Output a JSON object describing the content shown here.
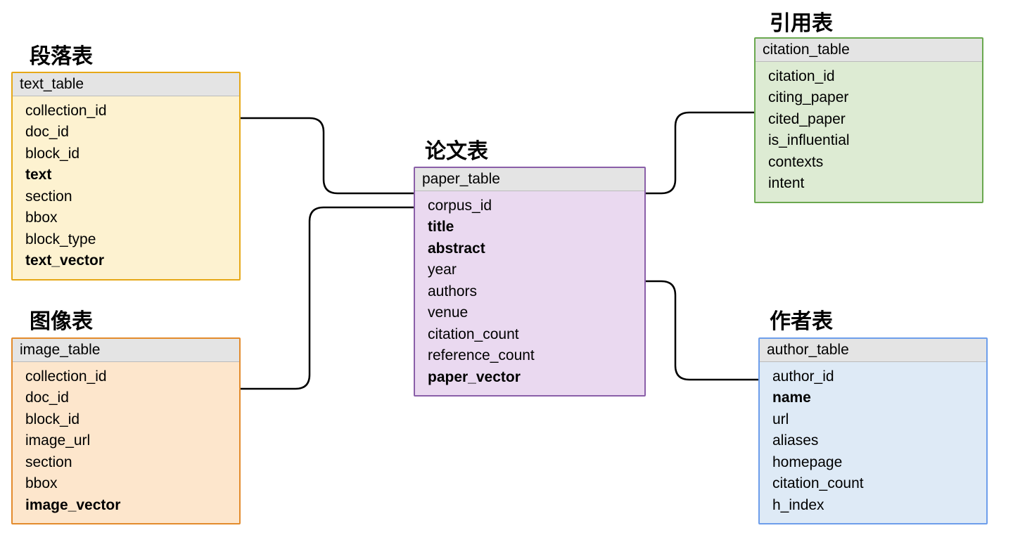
{
  "labels": {
    "text_table": "段落表",
    "image_table": "图像表",
    "paper_table": "论文表",
    "citation_table": "引用表",
    "author_table": "作者表"
  },
  "tables": {
    "text": {
      "name": "text_table",
      "fields": [
        {
          "name": "collection_id",
          "bold": false
        },
        {
          "name": "doc_id",
          "bold": false
        },
        {
          "name": "block_id",
          "bold": false
        },
        {
          "name": "text",
          "bold": true
        },
        {
          "name": "section",
          "bold": false
        },
        {
          "name": "bbox",
          "bold": false
        },
        {
          "name": "block_type",
          "bold": false
        },
        {
          "name": "text_vector",
          "bold": true
        }
      ]
    },
    "image": {
      "name": "image_table",
      "fields": [
        {
          "name": "collection_id",
          "bold": false
        },
        {
          "name": "doc_id",
          "bold": false
        },
        {
          "name": "block_id",
          "bold": false
        },
        {
          "name": "image_url",
          "bold": false
        },
        {
          "name": "section",
          "bold": false
        },
        {
          "name": "bbox",
          "bold": false
        },
        {
          "name": "image_vector",
          "bold": true
        }
      ]
    },
    "paper": {
      "name": "paper_table",
      "fields": [
        {
          "name": "corpus_id",
          "bold": false
        },
        {
          "name": "title",
          "bold": true
        },
        {
          "name": "abstract",
          "bold": true
        },
        {
          "name": "year",
          "bold": false
        },
        {
          "name": "authors",
          "bold": false
        },
        {
          "name": "venue",
          "bold": false
        },
        {
          "name": "citation_count",
          "bold": false
        },
        {
          "name": "reference_count",
          "bold": false
        },
        {
          "name": "paper_vector",
          "bold": true
        }
      ]
    },
    "citation": {
      "name": "citation_table",
      "fields": [
        {
          "name": "citation_id",
          "bold": false
        },
        {
          "name": "citing_paper",
          "bold": false
        },
        {
          "name": "cited_paper",
          "bold": false
        },
        {
          "name": "is_influential",
          "bold": false
        },
        {
          "name": "contexts",
          "bold": false
        },
        {
          "name": "intent",
          "bold": false
        }
      ]
    },
    "author": {
      "name": "author_table",
      "fields": [
        {
          "name": "author_id",
          "bold": false
        },
        {
          "name": "name",
          "bold": true
        },
        {
          "name": "url",
          "bold": false
        },
        {
          "name": "aliases",
          "bold": false
        },
        {
          "name": "homepage",
          "bold": false
        },
        {
          "name": "citation_count",
          "bold": false
        },
        {
          "name": "h_index",
          "bold": false
        }
      ]
    }
  }
}
